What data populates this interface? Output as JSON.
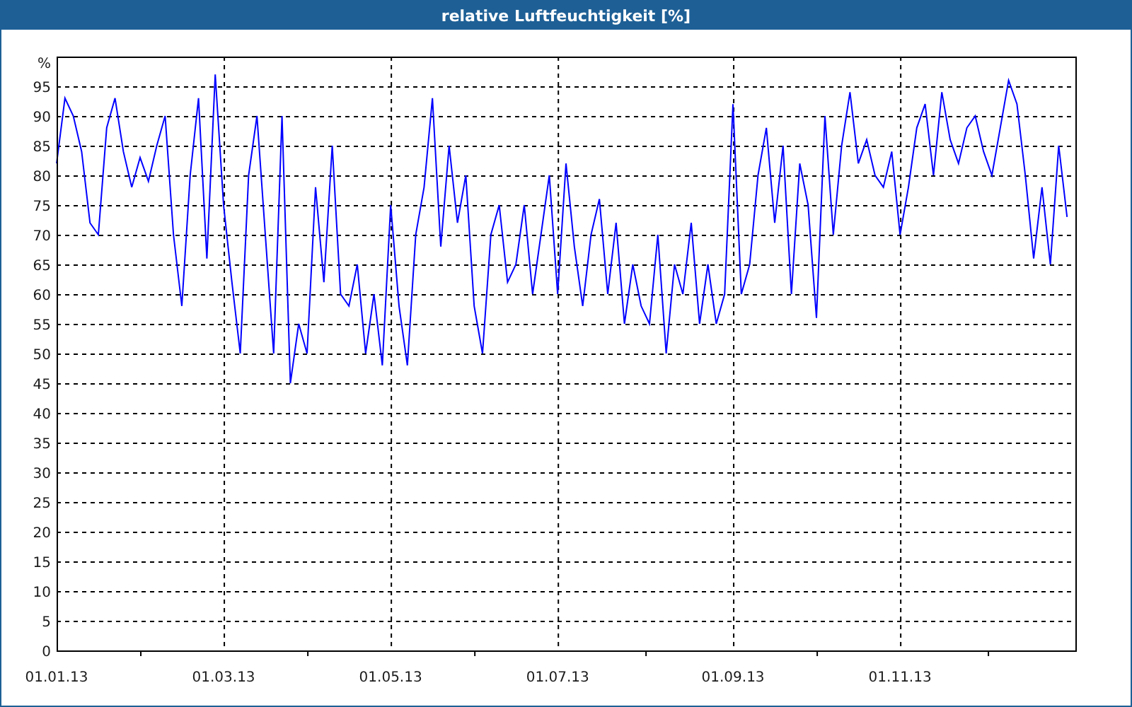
{
  "chart": {
    "chart_data": {
      "type": "line",
      "title": "relative Luftfeuchtigkeit [%]",
      "ylabel": "%",
      "categories": [
        "01.01.13",
        null,
        null,
        null,
        null,
        null,
        null,
        null,
        null,
        null,
        null,
        null,
        null,
        null,
        null,
        null,
        null,
        null,
        null,
        null,
        "01.03.13",
        null,
        null,
        null,
        null,
        null,
        null,
        null,
        null,
        null,
        null,
        null,
        null,
        null,
        null,
        null,
        null,
        null,
        null,
        null,
        "01.05.13",
        null,
        null,
        null,
        null,
        null,
        null,
        null,
        null,
        null,
        null,
        null,
        null,
        null,
        null,
        null,
        null,
        null,
        null,
        null,
        "01.07.13",
        null,
        null,
        null,
        null,
        null,
        null,
        null,
        null,
        null,
        null,
        null,
        null,
        null,
        null,
        null,
        null,
        null,
        null,
        null,
        null,
        "01.09.13",
        null,
        null,
        null,
        null,
        null,
        null,
        null,
        null,
        null,
        null,
        null,
        null,
        null,
        null,
        null,
        null,
        null,
        null,
        null,
        "01.11.13",
        null,
        null,
        null,
        null,
        null,
        null,
        null,
        null,
        null,
        null,
        null,
        null,
        null,
        null,
        null,
        null,
        null,
        null,
        null,
        null
      ],
      "series": [
        {
          "color": "#0000ff",
          "values": [
            82,
            93,
            90,
            84,
            72,
            70,
            88,
            93,
            84,
            78,
            83,
            79,
            85,
            90,
            70,
            58,
            80,
            93,
            66,
            97,
            75,
            62,
            50,
            80,
            90,
            70,
            50,
            90,
            45,
            55,
            50,
            78,
            62,
            85,
            60,
            58,
            65,
            50,
            60,
            48,
            75,
            58,
            48,
            70,
            78,
            93,
            68,
            85,
            72,
            80,
            58,
            50,
            70,
            75,
            62,
            65,
            75,
            60,
            70,
            80,
            60,
            82,
            68,
            58,
            70,
            76,
            60,
            72,
            55,
            65,
            58,
            55,
            70,
            50,
            65,
            60,
            72,
            55,
            65,
            55,
            60,
            92,
            60,
            65,
            80,
            88,
            72,
            85,
            60,
            82,
            75,
            56,
            90,
            70,
            85,
            94,
            82,
            86,
            80,
            78,
            84,
            70,
            78,
            88,
            92,
            80,
            94,
            86,
            82,
            88,
            90,
            84,
            80,
            88,
            96,
            92,
            80,
            66,
            78,
            65,
            85,
            73
          ]
        }
      ],
      "ylim": [
        0,
        100
      ],
      "grid": true,
      "yticks": [
        0,
        5,
        10,
        15,
        20,
        25,
        30,
        35,
        40,
        45,
        50,
        55,
        60,
        65,
        70,
        75,
        80,
        85,
        90,
        95
      ]
    }
  }
}
